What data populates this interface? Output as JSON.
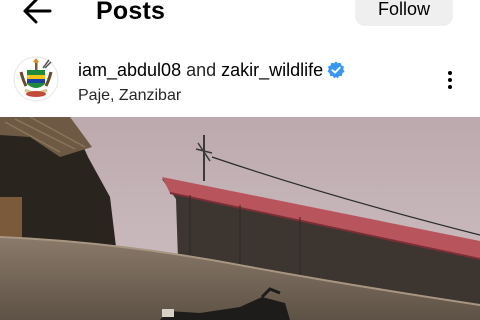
{
  "header": {
    "back_icon": "arrow-left-icon",
    "title": "Posts",
    "follow_label": "Follow"
  },
  "post": {
    "author": "iam_abdul08",
    "joiner": "and",
    "coauthor": "zakir_wildlife",
    "verified_icon": "verified-badge-icon",
    "location": "Paje, Zanzibar",
    "more_icon": "more-vertical-icon",
    "avatar_icon": "coat-of-arms-icon"
  },
  "colors": {
    "verified_blue": "#3897f0",
    "roof_red": "#b8545c",
    "sky": "#c9b8bd"
  }
}
